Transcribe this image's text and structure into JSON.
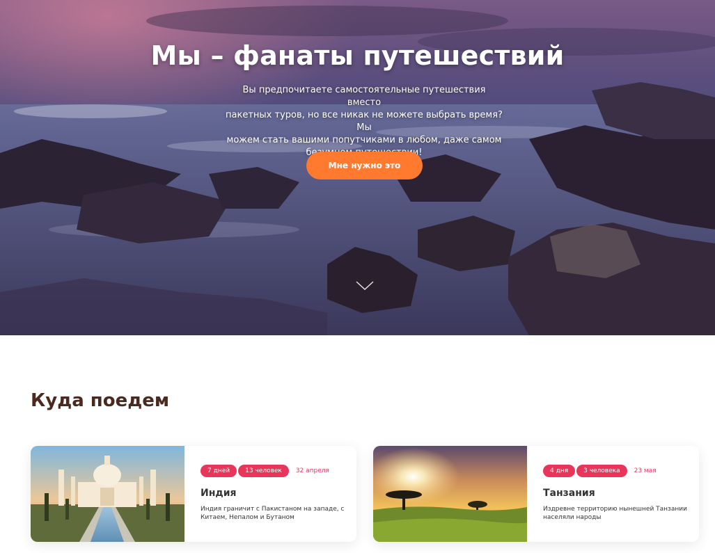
{
  "hero": {
    "title": "Мы – фанаты путешествий",
    "subtitle_lines": [
      "Вы предпочитаете самостоятельные путешествия вместо",
      "пакетных туров, но все никак не можете выбрать время? Мы",
      "можем стать вашими попутчиками в любом, даже самом",
      "безумном путешествии!"
    ],
    "cta_label": "Мне нужно это",
    "scroll_icon": "chevron-down-icon",
    "colors": {
      "cta": "#ff7a2e",
      "sky": "#5a4b78",
      "rocks": "#2a1f2e"
    }
  },
  "destinations": {
    "title": "Куда поедем",
    "cards": [
      {
        "duration": "7 дней",
        "people": "13 человек",
        "date": "32 апреля",
        "name": "Индия",
        "description": "Индия граничит с Пакистаном на западе, с Китаем, Непалом и Бутаном",
        "image": "taj-mahal-image"
      },
      {
        "duration": "4 дня",
        "people": "3 человека",
        "date": "23 мая",
        "name": "Танзания",
        "description": "Издревне территорию нынешней Танзании населяли народы",
        "image": "savanna-sunset-image"
      }
    ],
    "colors": {
      "tag": "#e8365a",
      "title": "#4a2a1e"
    }
  }
}
